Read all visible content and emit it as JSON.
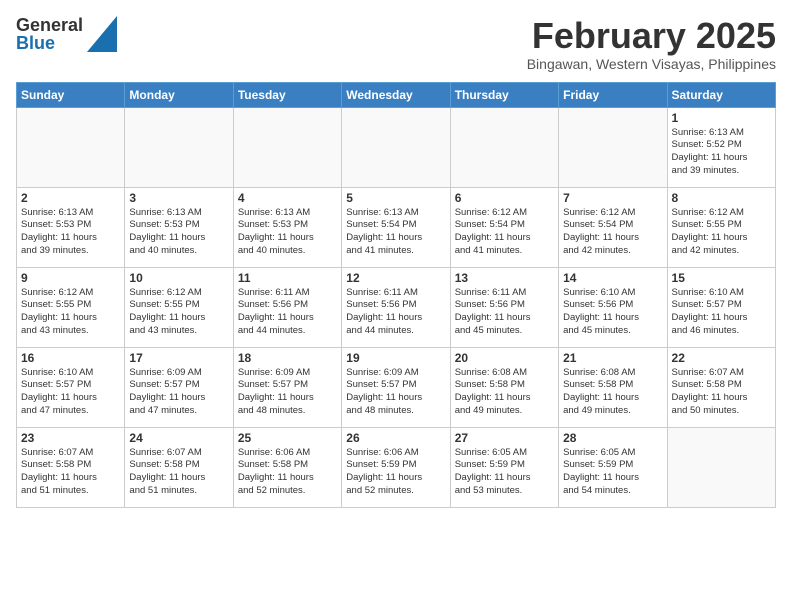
{
  "header": {
    "logo_general": "General",
    "logo_blue": "Blue",
    "month_title": "February 2025",
    "location": "Bingawan, Western Visayas, Philippines"
  },
  "weekdays": [
    "Sunday",
    "Monday",
    "Tuesday",
    "Wednesday",
    "Thursday",
    "Friday",
    "Saturday"
  ],
  "weeks": [
    [
      {
        "day": "",
        "info": ""
      },
      {
        "day": "",
        "info": ""
      },
      {
        "day": "",
        "info": ""
      },
      {
        "day": "",
        "info": ""
      },
      {
        "day": "",
        "info": ""
      },
      {
        "day": "",
        "info": ""
      },
      {
        "day": "1",
        "info": "Sunrise: 6:13 AM\nSunset: 5:52 PM\nDaylight: 11 hours\nand 39 minutes."
      }
    ],
    [
      {
        "day": "2",
        "info": "Sunrise: 6:13 AM\nSunset: 5:53 PM\nDaylight: 11 hours\nand 39 minutes."
      },
      {
        "day": "3",
        "info": "Sunrise: 6:13 AM\nSunset: 5:53 PM\nDaylight: 11 hours\nand 40 minutes."
      },
      {
        "day": "4",
        "info": "Sunrise: 6:13 AM\nSunset: 5:53 PM\nDaylight: 11 hours\nand 40 minutes."
      },
      {
        "day": "5",
        "info": "Sunrise: 6:13 AM\nSunset: 5:54 PM\nDaylight: 11 hours\nand 41 minutes."
      },
      {
        "day": "6",
        "info": "Sunrise: 6:12 AM\nSunset: 5:54 PM\nDaylight: 11 hours\nand 41 minutes."
      },
      {
        "day": "7",
        "info": "Sunrise: 6:12 AM\nSunset: 5:54 PM\nDaylight: 11 hours\nand 42 minutes."
      },
      {
        "day": "8",
        "info": "Sunrise: 6:12 AM\nSunset: 5:55 PM\nDaylight: 11 hours\nand 42 minutes."
      }
    ],
    [
      {
        "day": "9",
        "info": "Sunrise: 6:12 AM\nSunset: 5:55 PM\nDaylight: 11 hours\nand 43 minutes."
      },
      {
        "day": "10",
        "info": "Sunrise: 6:12 AM\nSunset: 5:55 PM\nDaylight: 11 hours\nand 43 minutes."
      },
      {
        "day": "11",
        "info": "Sunrise: 6:11 AM\nSunset: 5:56 PM\nDaylight: 11 hours\nand 44 minutes."
      },
      {
        "day": "12",
        "info": "Sunrise: 6:11 AM\nSunset: 5:56 PM\nDaylight: 11 hours\nand 44 minutes."
      },
      {
        "day": "13",
        "info": "Sunrise: 6:11 AM\nSunset: 5:56 PM\nDaylight: 11 hours\nand 45 minutes."
      },
      {
        "day": "14",
        "info": "Sunrise: 6:10 AM\nSunset: 5:56 PM\nDaylight: 11 hours\nand 45 minutes."
      },
      {
        "day": "15",
        "info": "Sunrise: 6:10 AM\nSunset: 5:57 PM\nDaylight: 11 hours\nand 46 minutes."
      }
    ],
    [
      {
        "day": "16",
        "info": "Sunrise: 6:10 AM\nSunset: 5:57 PM\nDaylight: 11 hours\nand 47 minutes."
      },
      {
        "day": "17",
        "info": "Sunrise: 6:09 AM\nSunset: 5:57 PM\nDaylight: 11 hours\nand 47 minutes."
      },
      {
        "day": "18",
        "info": "Sunrise: 6:09 AM\nSunset: 5:57 PM\nDaylight: 11 hours\nand 48 minutes."
      },
      {
        "day": "19",
        "info": "Sunrise: 6:09 AM\nSunset: 5:57 PM\nDaylight: 11 hours\nand 48 minutes."
      },
      {
        "day": "20",
        "info": "Sunrise: 6:08 AM\nSunset: 5:58 PM\nDaylight: 11 hours\nand 49 minutes."
      },
      {
        "day": "21",
        "info": "Sunrise: 6:08 AM\nSunset: 5:58 PM\nDaylight: 11 hours\nand 49 minutes."
      },
      {
        "day": "22",
        "info": "Sunrise: 6:07 AM\nSunset: 5:58 PM\nDaylight: 11 hours\nand 50 minutes."
      }
    ],
    [
      {
        "day": "23",
        "info": "Sunrise: 6:07 AM\nSunset: 5:58 PM\nDaylight: 11 hours\nand 51 minutes."
      },
      {
        "day": "24",
        "info": "Sunrise: 6:07 AM\nSunset: 5:58 PM\nDaylight: 11 hours\nand 51 minutes."
      },
      {
        "day": "25",
        "info": "Sunrise: 6:06 AM\nSunset: 5:58 PM\nDaylight: 11 hours\nand 52 minutes."
      },
      {
        "day": "26",
        "info": "Sunrise: 6:06 AM\nSunset: 5:59 PM\nDaylight: 11 hours\nand 52 minutes."
      },
      {
        "day": "27",
        "info": "Sunrise: 6:05 AM\nSunset: 5:59 PM\nDaylight: 11 hours\nand 53 minutes."
      },
      {
        "day": "28",
        "info": "Sunrise: 6:05 AM\nSunset: 5:59 PM\nDaylight: 11 hours\nand 54 minutes."
      },
      {
        "day": "",
        "info": ""
      }
    ]
  ]
}
